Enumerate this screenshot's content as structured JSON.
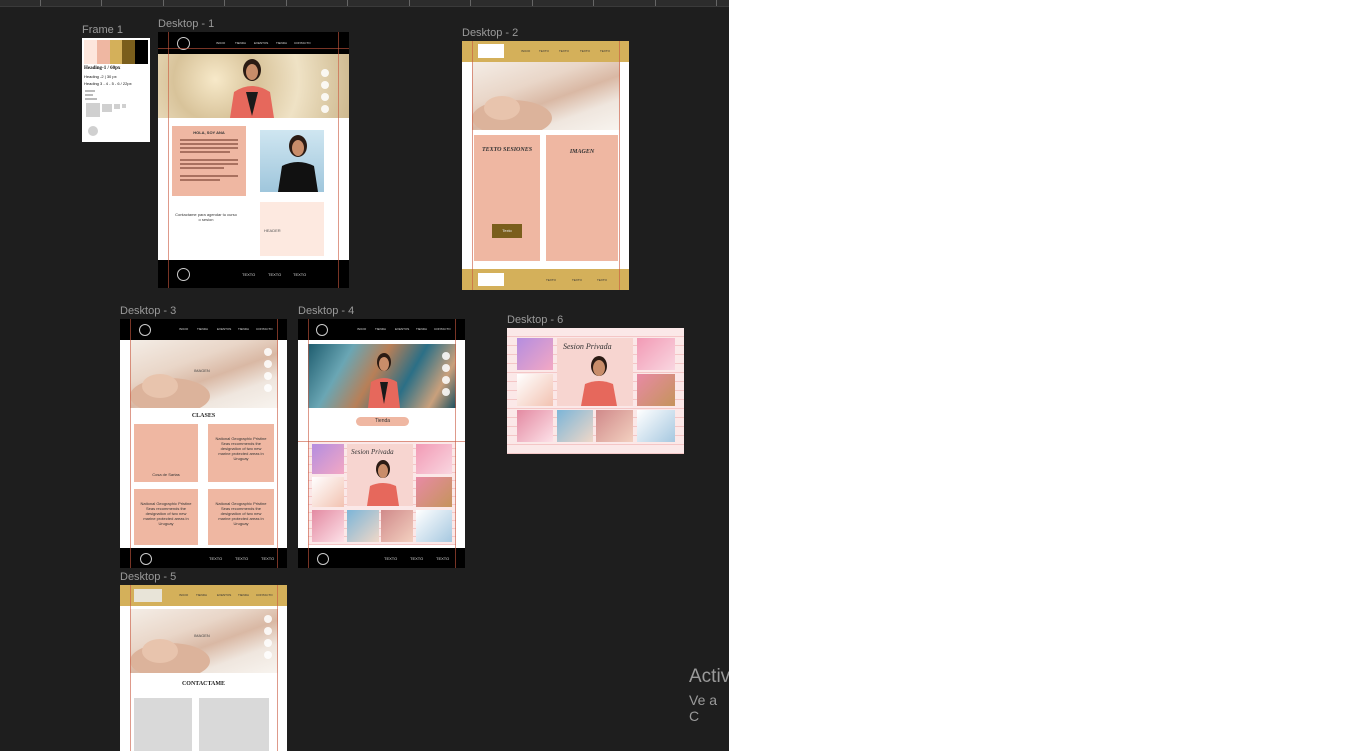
{
  "canvas": {
    "background": "#1e1e1e"
  },
  "frames": {
    "frame1": {
      "label": "Frame 1",
      "palette": [
        "#fde6dc",
        "#efb7a2",
        "#d4b05a",
        "#7a5e1c",
        "#000000"
      ],
      "heading1": "Heading-1 / 60px",
      "heading2": "Heading -2 | 30 px",
      "heading3": "Heading 3 - 4 - 5 - 6 / 22px"
    },
    "desktop1": {
      "label": "Desktop - 1",
      "nav": [
        "INICIO",
        "TIENDA",
        "EVENTOS",
        "TIENDA",
        "CONTACTO"
      ],
      "hola": "HOLA, SOY ANA",
      "contact_text": "Contactame para agendar tu curso o sesion",
      "header_text": "HEADER",
      "footer": [
        "TEXTO",
        "TEXTO",
        "TEXTO"
      ]
    },
    "desktop2": {
      "label": "Desktop - 2",
      "nav": [
        "INICIO",
        "TEXTO",
        "TEXTO",
        "TEXTO",
        "TEXTO"
      ],
      "texto_sesiones": "TEXTO SESIONES",
      "imagen": "IMAGEN",
      "button": "Texto",
      "footer": [
        "TEXTO",
        "TEXTO",
        "TEXTO"
      ]
    },
    "desktop3": {
      "label": "Desktop - 3",
      "nav": [
        "INICIO",
        "TIENDA",
        "EVENTOS",
        "TIENDA",
        "CONTACTO"
      ],
      "imagen": "IMAGEN",
      "clases": "CLASES",
      "box1": "Cosa de Sartas",
      "box2": "National Geographic Pristine Seas recommends the designation of two new marine protected areas in Uruguay",
      "box3": "National Geographic Pristine Seas recommends the designation of two new marine protected areas in Uruguay",
      "box4": "National Geographic Pristine Seas recommends the designation of two new marine protected areas in Uruguay",
      "footer": [
        "TEXTO",
        "TEXTO",
        "TEXTO"
      ]
    },
    "desktop4": {
      "label": "Desktop - 4",
      "nav": [
        "INICIO",
        "TIENDA",
        "EVENTOS",
        "TIENDA",
        "CONTACTO"
      ],
      "tienda": "Tienda",
      "poster_title": "Sesion Privada",
      "footer": [
        "TEXTO",
        "TEXTO",
        "TEXTO"
      ]
    },
    "desktop5": {
      "label": "Desktop - 5",
      "nav": [
        "INICIO",
        "TIENDA",
        "EVENTOS",
        "TIENDA",
        "CONTACTO"
      ],
      "imagen": "IMAGEN",
      "contactame": "CONTACTAME"
    },
    "desktop6": {
      "label": "Desktop - 6",
      "poster_title": "Sesion Privada"
    }
  },
  "watermark": {
    "line1": "Activ",
    "line2": "Ve a C"
  },
  "colors": {
    "pink": "#efb7a2",
    "gold": "#d4b05a",
    "black": "#000000",
    "coral": "#e86f62"
  }
}
